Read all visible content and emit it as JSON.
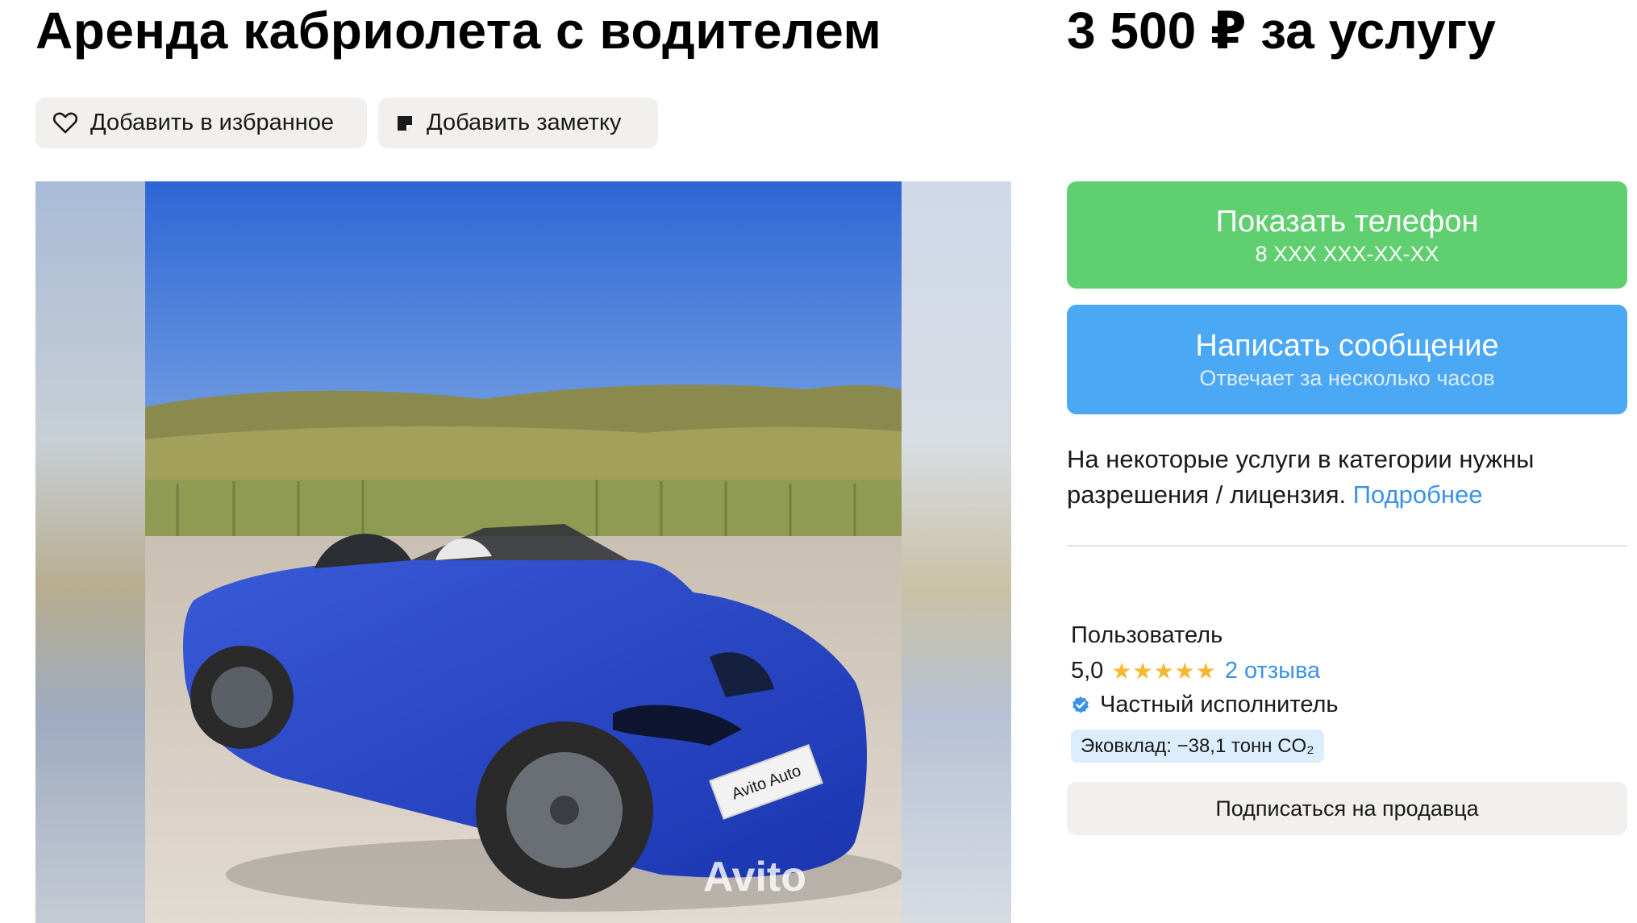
{
  "listing": {
    "title": "Аренда кабриолета с водителем",
    "price": "3 500 ₽ за услугу"
  },
  "actions": {
    "favorite_label": "Добавить в избранное",
    "note_label": "Добавить заметку"
  },
  "contact": {
    "phone_button_label": "Показать телефон",
    "phone_masked": "8 XXX XXX-XX-XX",
    "message_button_label": "Написать сообщение",
    "response_time": "Отвечает за несколько часов"
  },
  "license_notice": {
    "text": "На некоторые услуги в категории нужны разрешения / лицензия.",
    "link_label": "Подробнее"
  },
  "seller": {
    "name": "Пользователь",
    "rating": "5,0",
    "stars": 5,
    "reviews_label": "2 отзыва",
    "type_label": "Частный исполнитель",
    "eco_label": "Эковклад: −38,1 тонн CO₂",
    "subscribe_label": "Подписаться на продавца"
  },
  "photo": {
    "watermark": "Avito",
    "plate_text": "Avito Auto"
  },
  "colors": {
    "green_button": "#5fcf6f",
    "blue_button": "#4aa8f5",
    "link": "#3a92e8",
    "star": "#f7b731",
    "car_body": "#2a46c9"
  },
  "icons": {
    "favorite": "heart-outline-icon",
    "note": "note-icon",
    "verified": "verified-check-icon",
    "rating": "star-icon"
  }
}
